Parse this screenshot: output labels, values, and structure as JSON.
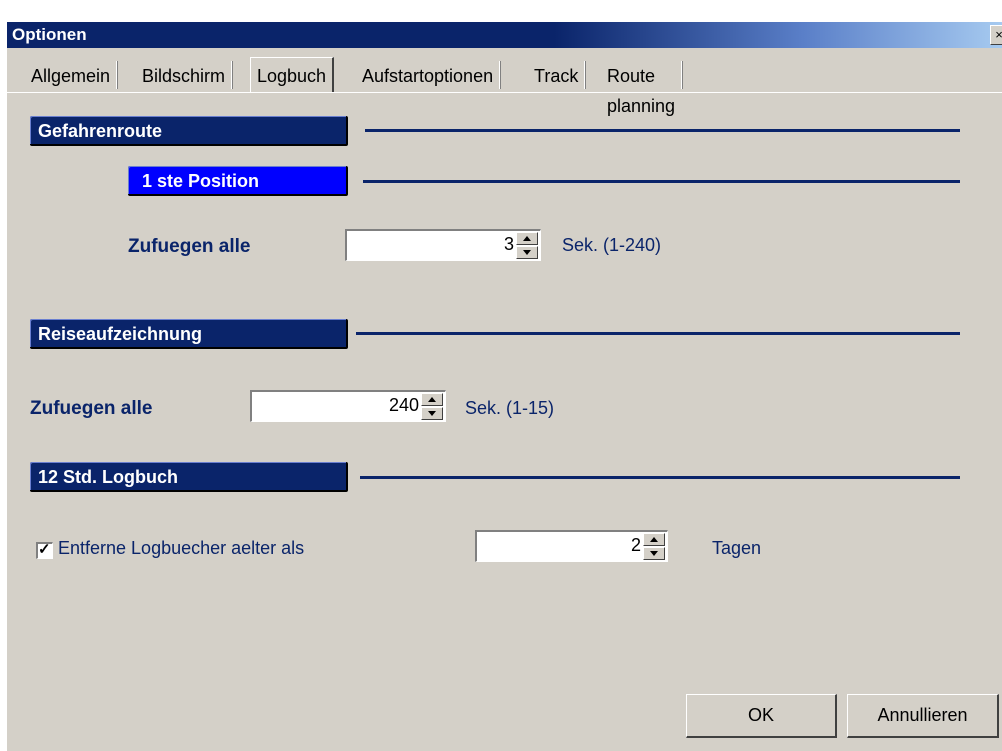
{
  "window": {
    "title": "Optionen",
    "close_glyph": "×"
  },
  "tabs": [
    {
      "label": "Allgemein"
    },
    {
      "label": "Bildschirm"
    },
    {
      "label": "Logbuch"
    },
    {
      "label": "Aufstartoptionen"
    },
    {
      "label": "Track"
    },
    {
      "label": "Route planning"
    }
  ],
  "active_tab": "Logbuch",
  "sections": {
    "gefahrenroute": {
      "header": "Gefahrenroute",
      "sub_header": "1 ste Position",
      "field_label": "Zufuegen alle",
      "value": "3",
      "unit": "Sek.  (1-240)"
    },
    "reiseaufzeichnung": {
      "header": "Reiseaufzeichnung",
      "field_label": "Zufuegen alle",
      "value": "240",
      "unit": "Sek. (1-15)"
    },
    "logbuch12": {
      "header": "12 Std. Logbuch",
      "checkbox_label": "Entferne Logbuecher aelter als",
      "checked": true,
      "value": "2",
      "unit": "Tagen"
    }
  },
  "buttons": {
    "ok": "OK",
    "cancel": "Annullieren"
  },
  "colors": {
    "titlebar": "#0a246a",
    "section_header": "#0a246a",
    "sub_header": "#0000ff",
    "dialog_bg": "#d4d0c8"
  }
}
